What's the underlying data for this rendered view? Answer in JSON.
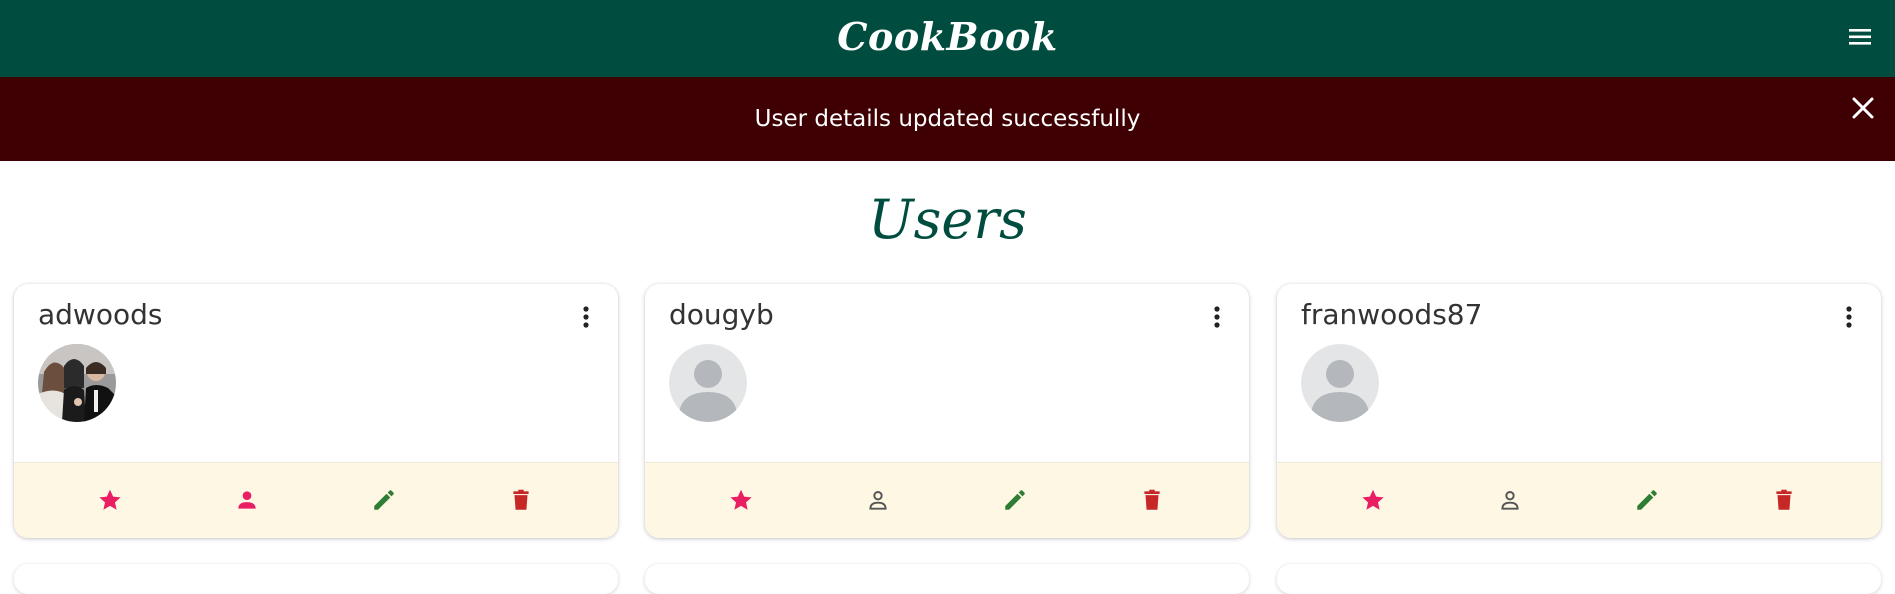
{
  "app": {
    "title": "CookBook"
  },
  "header": {
    "menu_icon": "hamburger-menu-icon"
  },
  "flash": {
    "message": "User details updated successfully",
    "close_icon": "close-icon"
  },
  "page": {
    "title": "Users"
  },
  "colors": {
    "header_bg": "#004d40",
    "flash_bg": "#3e0003",
    "favorite": "#e91e63",
    "profile_active": "#e91e63",
    "profile_inactive": "#555555",
    "edit": "#2e7d32",
    "delete": "#c62828",
    "actions_bg": "#fdf7e4"
  },
  "users": [
    {
      "username": "adwoods",
      "avatar": "photo",
      "actions": [
        {
          "name": "favorite",
          "icon": "star-icon"
        },
        {
          "name": "profile",
          "icon": "person-filled-icon"
        },
        {
          "name": "edit",
          "icon": "pencil-icon"
        },
        {
          "name": "delete",
          "icon": "trash-icon"
        }
      ]
    },
    {
      "username": "dougyb",
      "avatar": "placeholder",
      "actions": [
        {
          "name": "favorite",
          "icon": "star-icon"
        },
        {
          "name": "profile",
          "icon": "person-outline-icon"
        },
        {
          "name": "edit",
          "icon": "pencil-icon"
        },
        {
          "name": "delete",
          "icon": "trash-icon"
        }
      ]
    },
    {
      "username": "franwoods87",
      "avatar": "placeholder",
      "actions": [
        {
          "name": "favorite",
          "icon": "star-icon"
        },
        {
          "name": "profile",
          "icon": "person-outline-icon"
        },
        {
          "name": "edit",
          "icon": "pencil-icon"
        },
        {
          "name": "delete",
          "icon": "trash-icon"
        }
      ]
    }
  ]
}
